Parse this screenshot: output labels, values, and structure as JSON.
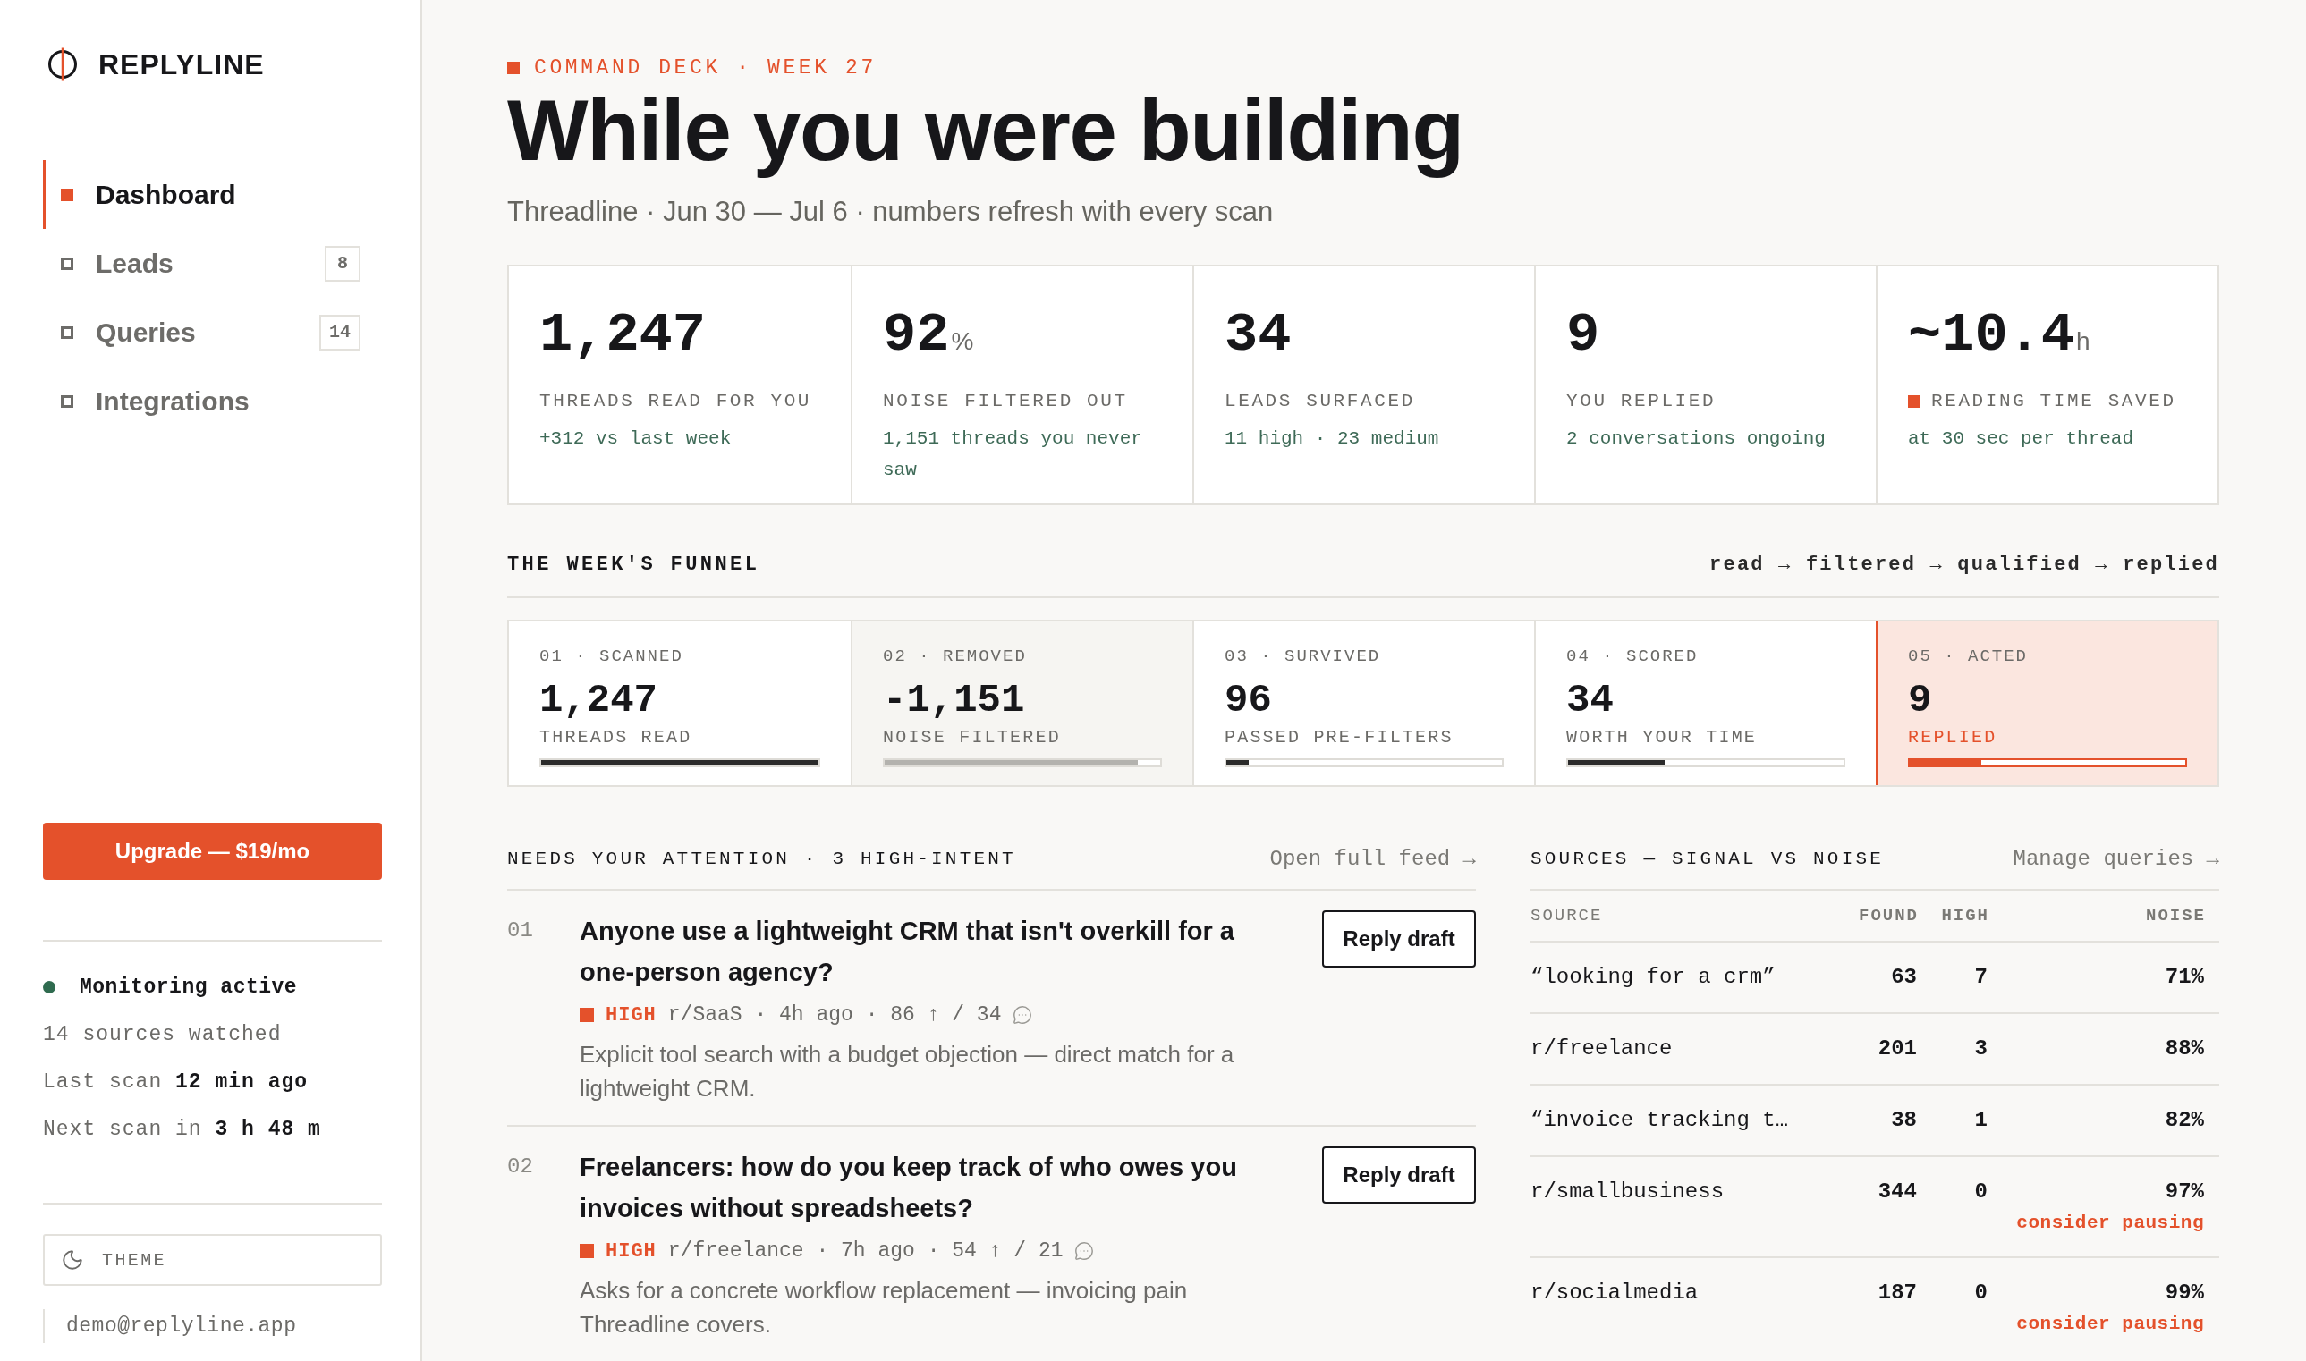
{
  "sidebar": {
    "brand": "REPLYLINE",
    "nav": [
      {
        "label": "Dashboard",
        "selected": true
      },
      {
        "label": "Leads",
        "selected": false,
        "count": "8"
      },
      {
        "label": "Queries",
        "selected": false,
        "count": "14"
      },
      {
        "label": "Integrations",
        "selected": false
      }
    ],
    "upgrade_button": "Upgrade — $19/mo",
    "monitoring": {
      "active": true,
      "status": "Monitoring active",
      "lines": [
        "14 sources watched",
        "Last scan **12 min ago**",
        "Next scan in **3 h 48 m**"
      ]
    },
    "theme_button": "THEME",
    "account": "demo@replyline.app"
  },
  "header": {
    "eyebrow": "COMMAND DECK · WEEK 27",
    "title": "While you were building",
    "subtitle": "Threadline · Jun 30 — Jul 6 · numbers refresh with every scan"
  },
  "stats": [
    {
      "value": "1,247",
      "label": "THREADS READ FOR YOU",
      "note": "+312 vs last week",
      "flagged": false
    },
    {
      "value": "92",
      "unit": "%",
      "label": "NOISE FILTERED OUT",
      "note": "1,151 threads you never saw",
      "flagged": false
    },
    {
      "value": "34",
      "label": "LEADS SURFACED",
      "note": "11 high · 23 medium",
      "flagged": false
    },
    {
      "value": "9",
      "label": "YOU REPLIED",
      "note": "2 conversations ongoing",
      "flagged": false
    },
    {
      "value": "~10.4",
      "unit": "h",
      "label": "READING TIME SAVED",
      "note": "at 30 sec per thread",
      "flagged": true
    }
  ],
  "funnel": {
    "title": "THE WEEK'S FUNNEL",
    "legend": "read → filtered → qualified → replied",
    "steps": [
      {
        "step": "01 · SCANNED",
        "value": "1,247",
        "label": "THREADS READ",
        "level": 1,
        "kind": "plain"
      },
      {
        "step": "02 · REMOVED",
        "value": "-1,151",
        "label": "NOISE FILTERED",
        "level": 0.92,
        "kind": "muted"
      },
      {
        "step": "03 · SURVIVED",
        "value": "96",
        "label": "PASSED PRE-FILTERS",
        "level": 0.08,
        "kind": "plain"
      },
      {
        "step": "04 · SCORED",
        "value": "34",
        "label": "WORTH YOUR TIME",
        "level": 0.35,
        "kind": "plain"
      },
      {
        "step": "05 · ACTED",
        "value": "9",
        "label": "REPLIED",
        "level": 0.26,
        "kind": "accent"
      }
    ]
  },
  "attention": {
    "title": "NEEDS YOUR ATTENTION · 3 HIGH-INTENT",
    "link": "Open full feed →",
    "items": [
      {
        "number": "01",
        "title": "Anyone use a lightweight CRM that isn't overkill for a one-person agency?",
        "priority": "HIGH",
        "meta": "r/SaaS · 4h ago · 86 ↑ / 34",
        "summary": "Explicit tool search with a budget objection — direct match for a lightweight CRM.",
        "button": "Reply draft"
      },
      {
        "number": "02",
        "title": "Freelancers: how do you keep track of who owes you invoices without spreadsheets?",
        "priority": "HIGH",
        "meta": "r/freelance · 7h ago · 54 ↑ / 21",
        "summary": "Asks for a concrete workflow replacement — invoicing pain Threadline covers.",
        "button": "Reply draft"
      }
    ]
  },
  "sources": {
    "title": "SOURCES — SIGNAL VS NOISE",
    "link": "Manage queries →",
    "columns": [
      "SOURCE",
      "FOUND",
      "HIGH",
      "NOISE"
    ],
    "rows": [
      {
        "source": "“looking for a crm”",
        "found": "63",
        "high": "7",
        "noise": "71%"
      },
      {
        "source": "r/freelance",
        "found": "201",
        "high": "3",
        "noise": "88%"
      },
      {
        "source": "“invoice tracking t…",
        "found": "38",
        "high": "1",
        "noise": "82%"
      },
      {
        "source": "r/smallbusiness",
        "found": "344",
        "high": "0",
        "noise": "97%",
        "warning": "consider pausing"
      },
      {
        "source": "r/socialmedia",
        "found": "187",
        "high": "0",
        "noise": "99%",
        "warning": "consider pausing"
      }
    ]
  }
}
